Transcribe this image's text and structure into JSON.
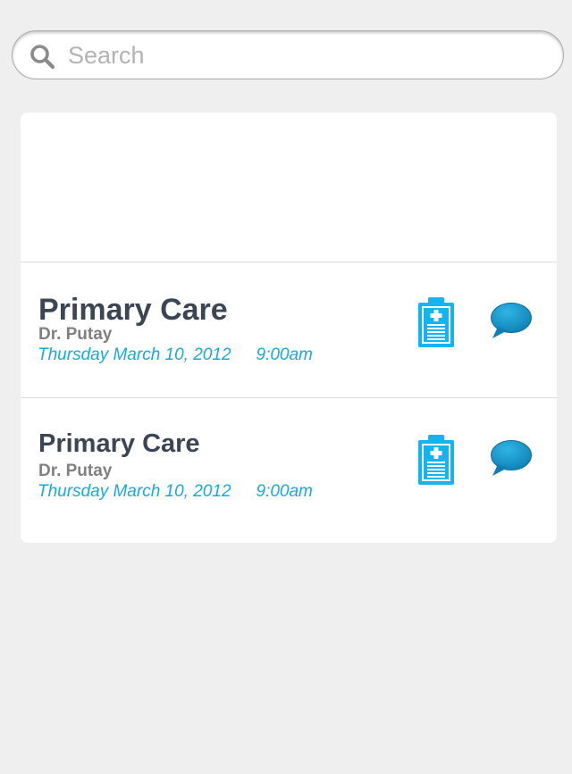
{
  "search": {
    "placeholder": "Search",
    "value": "",
    "icon": "search-icon"
  },
  "appointments": [
    {
      "title": "Primary Care",
      "doctor": "Dr. Putay",
      "date": "Thursday March 10, 2012",
      "time": "9:00am",
      "actions": [
        "clipboard-medical-icon",
        "chat-bubble-icon"
      ]
    },
    {
      "title": "Primary Care",
      "doctor": "Dr. Putay",
      "date": "Thursday March 10, 2012",
      "time": "9:00am",
      "actions": [
        "clipboard-medical-icon",
        "chat-bubble-icon"
      ]
    }
  ],
  "colors": {
    "background": "#efefef",
    "card": "#ffffff",
    "title": "#3c4552",
    "doctor": "#808080",
    "accent": "#19a9dc",
    "chat": "#1a8fc3"
  }
}
